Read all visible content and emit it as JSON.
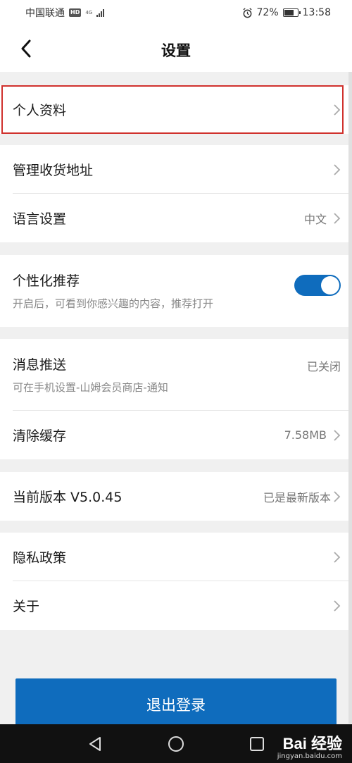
{
  "status_bar": {
    "carrier": "中国联通",
    "hd": "HD",
    "network": "4G",
    "battery": "72%",
    "time": "13:58"
  },
  "header": {
    "title": "设置"
  },
  "sections": {
    "profile": {
      "label": "个人资料"
    },
    "address": {
      "label": "管理收货地址"
    },
    "language": {
      "label": "语言设置",
      "value": "中文"
    },
    "personalized": {
      "label": "个性化推荐",
      "description": "开启后，可看到你感兴趣的内容，推荐打开",
      "enabled": true
    },
    "push": {
      "label": "消息推送",
      "value": "已关闭",
      "description": "可在手机设置-山姆会员商店-通知"
    },
    "cache": {
      "label": "清除缓存",
      "value": "7.58MB"
    },
    "version": {
      "label": "当前版本 V5.0.45",
      "value": "已是最新版本"
    },
    "privacy": {
      "label": "隐私政策"
    },
    "about": {
      "label": "关于"
    }
  },
  "logout": {
    "label": "退出登录"
  },
  "watermark": {
    "brand": "Bai 经验",
    "url": "jingyan.baidu.com"
  },
  "colors": {
    "accent": "#0f6cbd",
    "highlight": "#d0312d"
  }
}
